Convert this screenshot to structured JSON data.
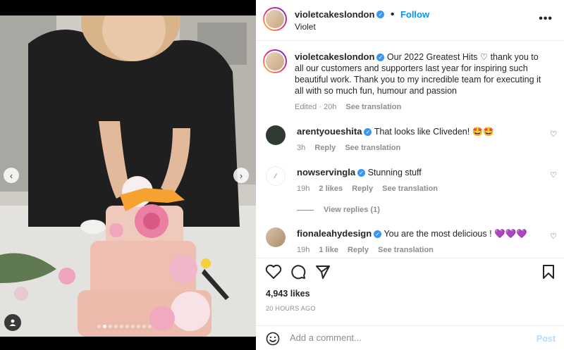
{
  "post": {
    "author": "violetcakeslondon",
    "follow_label": "Follow",
    "location": "Violet",
    "more_label": "•••",
    "accent": "#0095f6",
    "verified_color": "#3897f0"
  },
  "carousel": {
    "prev_label": "‹",
    "next_label": "›",
    "dot_count": 10,
    "active_index": 1
  },
  "caption": {
    "author": "violetcakeslondon",
    "text": "Our 2022 Greatest Hits ♡ thank you to all our customers and supporters last year for inspiring such beautiful work. Thank you to my incredible team for executing it all with so much fun, humour and passion",
    "edited": "Edited · 20h",
    "see_translation": "See translation"
  },
  "comments": [
    {
      "author": "arentyoueshita",
      "text": "That looks like Cliveden! 🤩🤩",
      "time": "3h",
      "likes": "",
      "reply": "Reply",
      "see_translation": "See translation",
      "view_replies": "",
      "avatar_color": "#2f3a33"
    },
    {
      "author": "nowservingla",
      "text": "Stunning stuff",
      "time": "19h",
      "likes": "2 likes",
      "reply": "Reply",
      "see_translation": "See translation",
      "view_replies": "View replies (1)",
      "avatar_color": "#ffffff"
    },
    {
      "author": "fionaleahydesign",
      "text": "You are the most delicious ! 💜💜💜",
      "time": "19h",
      "likes": "1 like",
      "reply": "Reply",
      "see_translation": "See translation",
      "view_replies": "",
      "avatar_color": "#c9b49a"
    }
  ],
  "engagement": {
    "likes": "4,943 likes",
    "time_ago": "20 HOURS AGO"
  },
  "add_comment": {
    "placeholder": "Add a comment...",
    "post_label": "Post"
  }
}
